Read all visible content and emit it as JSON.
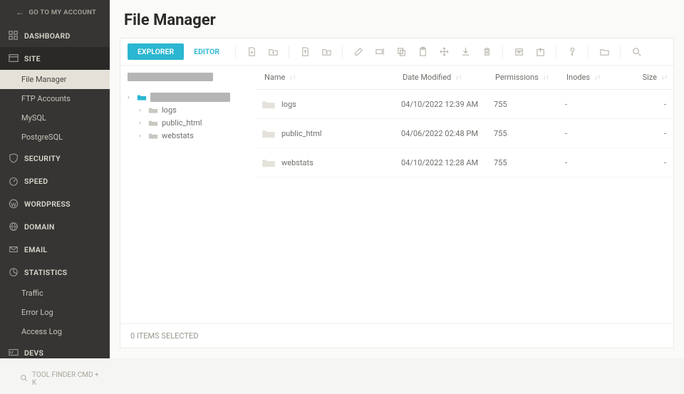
{
  "top_link": "GO TO MY ACCOUNT",
  "sidebar": {
    "dashboard": "DASHBOARD",
    "site": "SITE",
    "site_items": [
      "File Manager",
      "FTP Accounts",
      "MySQL",
      "PostgreSQL"
    ],
    "security": "SECURITY",
    "speed": "SPEED",
    "wordpress": "WORDPRESS",
    "domain": "DOMAIN",
    "email": "EMAIL",
    "statistics": "STATISTICS",
    "statistics_items": [
      "Traffic",
      "Error Log",
      "Access Log"
    ],
    "devs": "DEVS",
    "toolfinder": "TOOL FINDER CMD + K"
  },
  "page_title": "File Manager",
  "tabs": {
    "explorer": "EXPLORER",
    "editor": "EDITOR"
  },
  "tree": {
    "children": [
      "logs",
      "public_html",
      "webstats"
    ]
  },
  "columns": {
    "name": "Name",
    "date": "Date Modified",
    "perm": "Permissions",
    "inodes": "Inodes",
    "size": "Size"
  },
  "rows": [
    {
      "name": "logs",
      "date": "04/10/2022 12:39 AM",
      "perm": "755",
      "inodes": "-",
      "size": "-"
    },
    {
      "name": "public_html",
      "date": "04/06/2022 02:48 PM",
      "perm": "755",
      "inodes": "-",
      "size": "-"
    },
    {
      "name": "webstats",
      "date": "04/10/2022 12:28 AM",
      "perm": "755",
      "inodes": "-",
      "size": "-"
    }
  ],
  "footer": "0 ITEMS SELECTED"
}
